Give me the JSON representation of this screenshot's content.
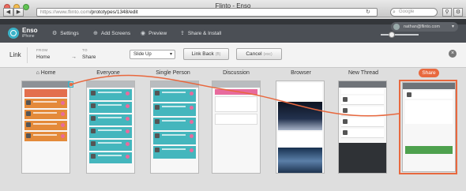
{
  "window": {
    "title": "Flinto - Enso"
  },
  "browser": {
    "url_host": "https://www.flinto.com",
    "url_path": "/prototypes/1348/edit",
    "search_placeholder": "Google",
    "back_icon": "chevron-left-icon",
    "forward_icon": "chevron-right-icon"
  },
  "app": {
    "brand_name": "Enso",
    "brand_sub": "iPhone",
    "nav": [
      {
        "label": "Settings",
        "icon": "gear-icon"
      },
      {
        "label": "Add Screens",
        "icon": "plus-circle-icon"
      },
      {
        "label": "Preview",
        "icon": "eye-icon"
      },
      {
        "label": "Share & Install",
        "icon": "share-icon"
      }
    ],
    "zoom_level": 0.3,
    "user_email": "nathan@flinto.com"
  },
  "linkbar": {
    "title": "Link",
    "from_label": "FROM",
    "from_value": "Home",
    "to_label": "TO",
    "to_value": "Share",
    "transition": "Slide Up",
    "link_back_label": "Link Back",
    "link_back_key": "(B)",
    "cancel_label": "Cancel",
    "cancel_key": "(esc)"
  },
  "screens": [
    {
      "name": "Home"
    },
    {
      "name": "Everyone"
    },
    {
      "name": "Single Person"
    },
    {
      "name": "Discussion"
    },
    {
      "name": "Browser"
    },
    {
      "name": "New Thread"
    },
    {
      "name": "Share"
    }
  ],
  "colors": {
    "accent": "#3ab2c8",
    "share": "#e8683e",
    "teal_card": "#44b6bd",
    "pink_dot": "#e86b9d"
  }
}
